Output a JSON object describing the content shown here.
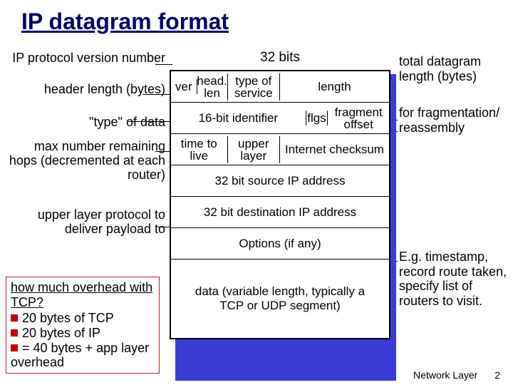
{
  "title": "IP datagram format",
  "bits_header": "32 bits",
  "left_labels": {
    "version": "IP protocol version number",
    "hlen": "header length (bytes)",
    "tos": "\"type\" of data",
    "ttl": "max number remaining hops (decremented at each router)",
    "proto": "upper layer protocol to deliver payload to"
  },
  "right_labels": {
    "totlen": "total datagram length (bytes)",
    "frag": "for fragmentation/ reassembly",
    "opts": "E.g. timestamp, record route taken, specify list of routers to visit."
  },
  "table": {
    "ver": "ver",
    "hlen": "head. len",
    "tos": "type of service",
    "length": "length",
    "ident": "16-bit identifier",
    "flgs": "flgs",
    "fragoff": "fragment offset",
    "ttl": "time to live",
    "upper": "upper layer",
    "cksum": "Internet checksum",
    "src": "32 bit source IP address",
    "dst": "32 bit destination IP address",
    "opts": "Options (if any)",
    "data": "data (variable length, typically a TCP or UDP segment)"
  },
  "overhead": {
    "q": "how much overhead with TCP?",
    "b1": "20 bytes of TCP",
    "b2": "20 bytes of IP",
    "b3": "= 40 bytes + app layer overhead"
  },
  "footer": {
    "label": "Network Layer",
    "page": "2"
  }
}
